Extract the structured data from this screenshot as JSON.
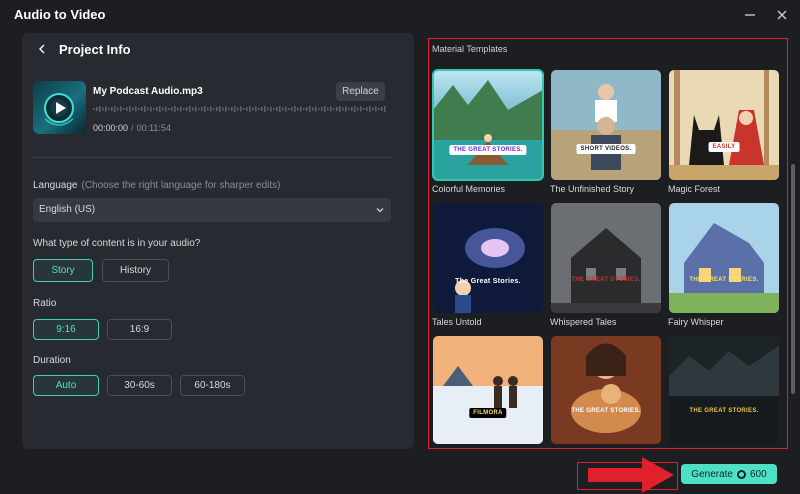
{
  "window": {
    "title": "Audio to Video"
  },
  "project": {
    "title": "Project Info",
    "file_name": "My Podcast Audio.mp3",
    "replace_label": "Replace",
    "time_current": "00:00:00",
    "time_separator": "/",
    "time_total": "00:11:54"
  },
  "language": {
    "label": "Language",
    "hint": "(Choose the right language for sharper edits)",
    "value": "English (US)"
  },
  "content_type": {
    "label": "What type of content is in your audio?",
    "options": [
      "Story",
      "History"
    ],
    "selected": "Story"
  },
  "ratio": {
    "label": "Ratio",
    "options": [
      "9:16",
      "16:9"
    ],
    "selected": "9:16"
  },
  "duration": {
    "label": "Duration",
    "options": [
      "Auto",
      "30-60s",
      "60-180s"
    ],
    "selected": "Auto"
  },
  "templates": {
    "heading": "Material Templates",
    "selected": "Colorful Memories",
    "items": [
      {
        "name": "Colorful Memories",
        "badge": "THE GREAT STORIES."
      },
      {
        "name": "The Unfinished Story",
        "badge": "SHORT VIDEOS."
      },
      {
        "name": "Magic Forest",
        "badge": "EASILY"
      },
      {
        "name": "Tales Untold",
        "badge": "The Great Stories."
      },
      {
        "name": "Whispered Tales",
        "badge": "THE GREAT STORIES."
      },
      {
        "name": "Fairy Whisper",
        "badge": "THE GREAT STORIES."
      },
      {
        "name": "",
        "badge": "FILMORA"
      },
      {
        "name": "",
        "badge": "THE GREAT STORIES."
      },
      {
        "name": "",
        "badge": "THE GREAT STORIES."
      }
    ]
  },
  "generate": {
    "label": "Generate",
    "credits": "600"
  },
  "colors": {
    "accent": "#4ee0c4",
    "highlight_red": "#e0202d",
    "background": "#1c1e22",
    "panel": "#272a30"
  },
  "icons": {
    "back": "chevron-left-icon",
    "minimize": "minimize-icon",
    "close": "close-icon",
    "dropdown": "chevron-down-icon",
    "play": "play-icon",
    "credits": "credit-coin-icon"
  }
}
